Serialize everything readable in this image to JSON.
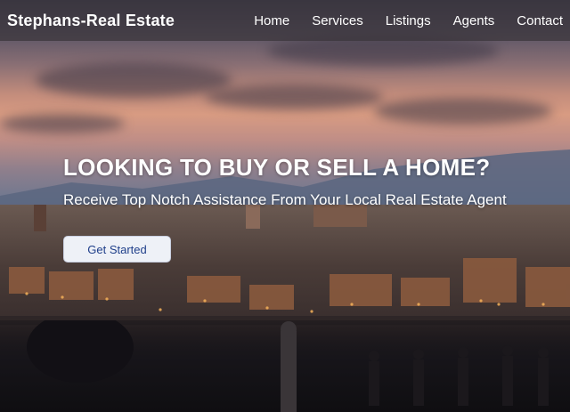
{
  "navbar": {
    "brand": "Stephans-Real Estate",
    "links": [
      {
        "label": "Home"
      },
      {
        "label": "Services"
      },
      {
        "label": "Listings"
      },
      {
        "label": "Agents"
      },
      {
        "label": "Contact"
      }
    ]
  },
  "hero": {
    "title": "LOOKING TO BUY OR SELL A HOME?",
    "subtitle": "Receive Top Notch Assistance From Your Local Real Estate Agent",
    "cta_label": "Get Started"
  },
  "colors": {
    "navbar_bg": "#3a343a",
    "cta_text": "#1f3f8a",
    "cta_bg": "#eef1f7"
  }
}
